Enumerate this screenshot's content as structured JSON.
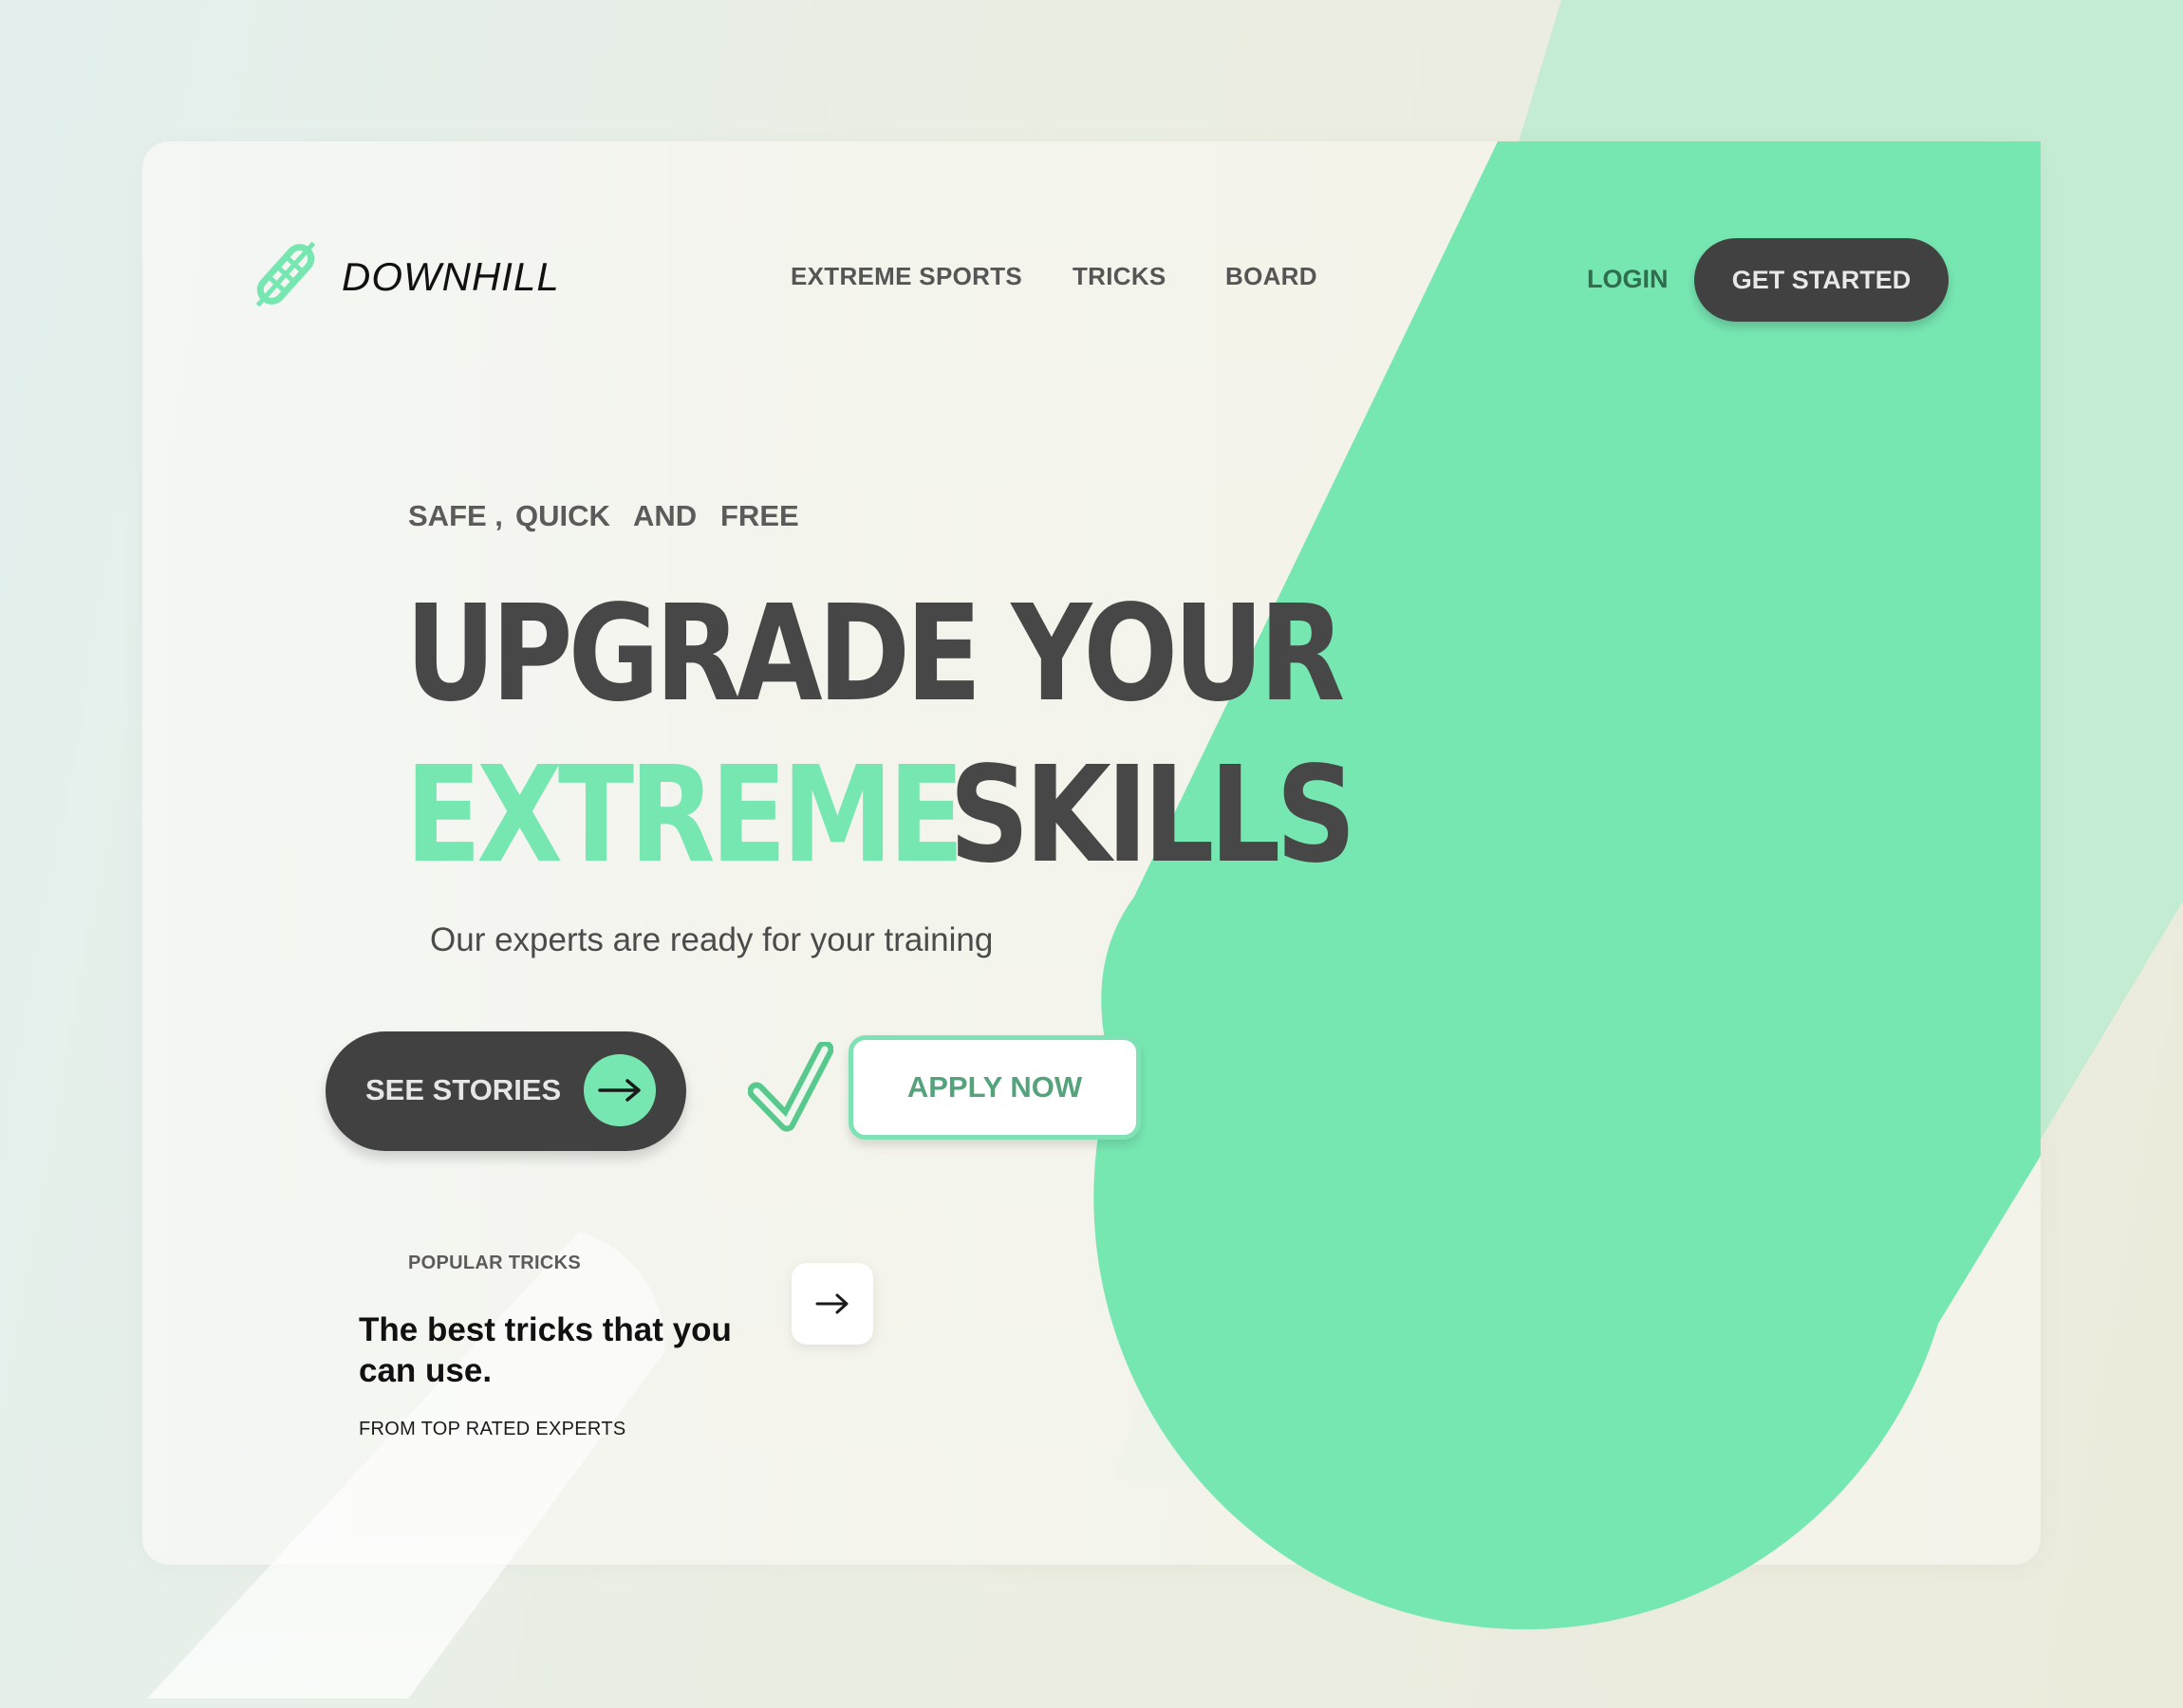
{
  "brand": {
    "name": "DOWNHILL",
    "logo_icon": "skateboard-icon"
  },
  "nav": {
    "items": [
      {
        "label": "EXTREME SPORTS"
      },
      {
        "label": "TRICKS"
      },
      {
        "label": "BOARD"
      }
    ],
    "login_label": "LOGIN",
    "cta_label": "GET STARTED"
  },
  "hero": {
    "tagline": [
      "SAFE ,",
      "QUICK",
      "AND",
      "FREE"
    ],
    "headline_line1": "UPGRADE YOUR",
    "headline_line2_accent": "EXTREME",
    "headline_line2_rest": "SKILLS",
    "subtitle": "Our experts are ready for your training",
    "primary_button_label": "SEE STORIES",
    "primary_button_icon": "arrow-right-icon",
    "check_icon": "checkmark-icon",
    "secondary_button_label": "APPLY NOW"
  },
  "popular": {
    "label": "POPULAR TRICKS",
    "title": "The best tricks  that you can use.",
    "subtitle": "FROM TOP RATED EXPERTS",
    "arrow_icon": "arrow-right-icon"
  },
  "colors": {
    "accent_green": "#77e7b2",
    "light_green": "#c3ecd2",
    "dark_button": "#414141",
    "headline_gray": "#474747"
  }
}
